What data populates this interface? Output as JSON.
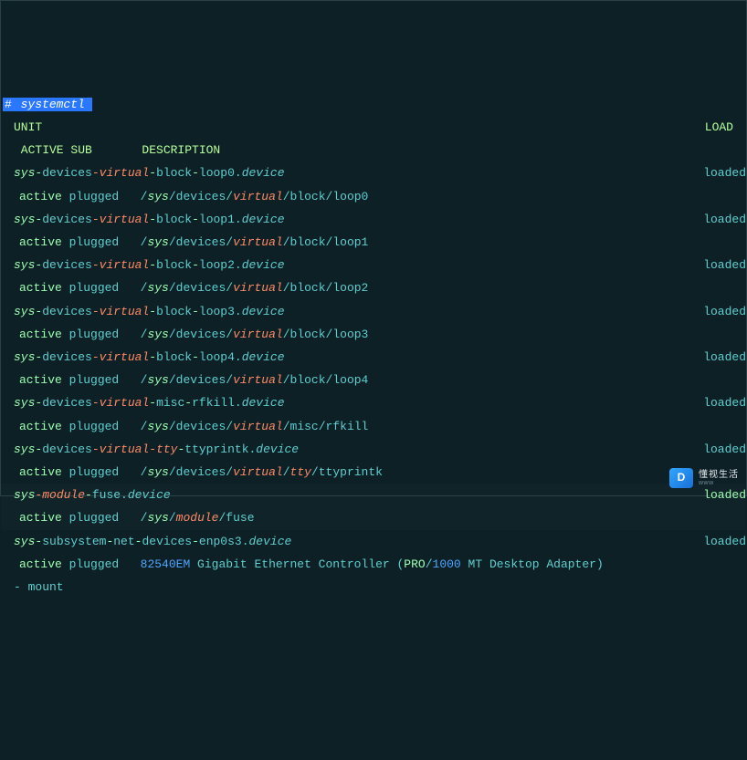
{
  "prompt": {
    "hash": "#",
    "command": " systemctl "
  },
  "header": {
    "unit": "UNIT",
    "load": "LOAD",
    "active": "ACTIVE",
    "sub": "SUB",
    "description": "DESCRIPTION"
  },
  "loaded_label": "loaded",
  "units": [
    {
      "segments": [
        {
          "t": "sys",
          "c": "gi"
        },
        {
          "t": "-",
          "c": "g"
        },
        {
          "t": "devices",
          "c": "t"
        },
        {
          "t": "-",
          "c": "o"
        },
        {
          "t": "virtual",
          "c": "oi"
        },
        {
          "t": "-",
          "c": "g"
        },
        {
          "t": "block",
          "c": "t"
        },
        {
          "t": "-",
          "c": "g"
        },
        {
          "t": "loop0.",
          "c": "t"
        },
        {
          "t": "device",
          "c": "ti"
        }
      ],
      "desc": [
        {
          "t": "active",
          "c": "g"
        },
        {
          "t": " ",
          "c": "t"
        },
        {
          "t": "plugged",
          "c": "t"
        },
        {
          "t": "   /",
          "c": "t"
        },
        {
          "t": "sys",
          "c": "gi"
        },
        {
          "t": "/",
          "c": "t"
        },
        {
          "t": "devices",
          "c": "t"
        },
        {
          "t": "/",
          "c": "t"
        },
        {
          "t": "virtual",
          "c": "oi"
        },
        {
          "t": "/",
          "c": "t"
        },
        {
          "t": "block",
          "c": "t"
        },
        {
          "t": "/",
          "c": "t"
        },
        {
          "t": "loop0",
          "c": "t"
        }
      ],
      "loaded_color": "t"
    },
    {
      "segments": [
        {
          "t": "sys",
          "c": "gi"
        },
        {
          "t": "-",
          "c": "g"
        },
        {
          "t": "devices",
          "c": "t"
        },
        {
          "t": "-",
          "c": "o"
        },
        {
          "t": "virtual",
          "c": "oi"
        },
        {
          "t": "-",
          "c": "g"
        },
        {
          "t": "block",
          "c": "t"
        },
        {
          "t": "-",
          "c": "g"
        },
        {
          "t": "loop1.",
          "c": "t"
        },
        {
          "t": "device",
          "c": "ti"
        }
      ],
      "desc": [
        {
          "t": "active",
          "c": "g"
        },
        {
          "t": " ",
          "c": "t"
        },
        {
          "t": "plugged",
          "c": "t"
        },
        {
          "t": "   /",
          "c": "t"
        },
        {
          "t": "sys",
          "c": "gi"
        },
        {
          "t": "/",
          "c": "t"
        },
        {
          "t": "devices",
          "c": "t"
        },
        {
          "t": "/",
          "c": "t"
        },
        {
          "t": "virtual",
          "c": "oi"
        },
        {
          "t": "/",
          "c": "t"
        },
        {
          "t": "block",
          "c": "t"
        },
        {
          "t": "/",
          "c": "t"
        },
        {
          "t": "loop1",
          "c": "t"
        }
      ],
      "loaded_color": "t"
    },
    {
      "segments": [
        {
          "t": "sys",
          "c": "gi"
        },
        {
          "t": "-",
          "c": "g"
        },
        {
          "t": "devices",
          "c": "t"
        },
        {
          "t": "-",
          "c": "o"
        },
        {
          "t": "virtual",
          "c": "oi"
        },
        {
          "t": "-",
          "c": "g"
        },
        {
          "t": "block",
          "c": "t"
        },
        {
          "t": "-",
          "c": "g"
        },
        {
          "t": "loop2.",
          "c": "t"
        },
        {
          "t": "device",
          "c": "ti"
        }
      ],
      "desc": [
        {
          "t": "active",
          "c": "g"
        },
        {
          "t": " ",
          "c": "t"
        },
        {
          "t": "plugged",
          "c": "t"
        },
        {
          "t": "   /",
          "c": "t"
        },
        {
          "t": "sys",
          "c": "gi"
        },
        {
          "t": "/",
          "c": "t"
        },
        {
          "t": "devices",
          "c": "t"
        },
        {
          "t": "/",
          "c": "t"
        },
        {
          "t": "virtual",
          "c": "oi"
        },
        {
          "t": "/",
          "c": "t"
        },
        {
          "t": "block",
          "c": "t"
        },
        {
          "t": "/",
          "c": "t"
        },
        {
          "t": "loop2",
          "c": "t"
        }
      ],
      "loaded_color": "t"
    },
    {
      "segments": [
        {
          "t": "sys",
          "c": "gi"
        },
        {
          "t": "-",
          "c": "g"
        },
        {
          "t": "devices",
          "c": "t"
        },
        {
          "t": "-",
          "c": "o"
        },
        {
          "t": "virtual",
          "c": "oi"
        },
        {
          "t": "-",
          "c": "g"
        },
        {
          "t": "block",
          "c": "t"
        },
        {
          "t": "-",
          "c": "g"
        },
        {
          "t": "loop3.",
          "c": "t"
        },
        {
          "t": "device",
          "c": "ti"
        }
      ],
      "desc": [
        {
          "t": "active",
          "c": "g"
        },
        {
          "t": " ",
          "c": "t"
        },
        {
          "t": "plugged",
          "c": "t"
        },
        {
          "t": "   /",
          "c": "t"
        },
        {
          "t": "sys",
          "c": "gi"
        },
        {
          "t": "/",
          "c": "t"
        },
        {
          "t": "devices",
          "c": "t"
        },
        {
          "t": "/",
          "c": "t"
        },
        {
          "t": "virtual",
          "c": "oi"
        },
        {
          "t": "/",
          "c": "t"
        },
        {
          "t": "block",
          "c": "t"
        },
        {
          "t": "/",
          "c": "t"
        },
        {
          "t": "loop3",
          "c": "t"
        }
      ],
      "loaded_color": "t"
    },
    {
      "segments": [
        {
          "t": "sys",
          "c": "gi"
        },
        {
          "t": "-",
          "c": "g"
        },
        {
          "t": "devices",
          "c": "t"
        },
        {
          "t": "-",
          "c": "o"
        },
        {
          "t": "virtual",
          "c": "oi"
        },
        {
          "t": "-",
          "c": "g"
        },
        {
          "t": "block",
          "c": "t"
        },
        {
          "t": "-",
          "c": "g"
        },
        {
          "t": "loop4.",
          "c": "t"
        },
        {
          "t": "device",
          "c": "ti"
        }
      ],
      "desc": [
        {
          "t": "active",
          "c": "g"
        },
        {
          "t": " ",
          "c": "t"
        },
        {
          "t": "plugged",
          "c": "t"
        },
        {
          "t": "   /",
          "c": "t"
        },
        {
          "t": "sys",
          "c": "gi"
        },
        {
          "t": "/",
          "c": "t"
        },
        {
          "t": "devices",
          "c": "t"
        },
        {
          "t": "/",
          "c": "t"
        },
        {
          "t": "virtual",
          "c": "oi"
        },
        {
          "t": "/",
          "c": "t"
        },
        {
          "t": "block",
          "c": "t"
        },
        {
          "t": "/",
          "c": "t"
        },
        {
          "t": "loop4",
          "c": "t"
        }
      ],
      "loaded_color": "t"
    },
    {
      "segments": [
        {
          "t": "sys",
          "c": "gi"
        },
        {
          "t": "-",
          "c": "g"
        },
        {
          "t": "devices",
          "c": "t"
        },
        {
          "t": "-",
          "c": "o"
        },
        {
          "t": "virtual",
          "c": "oi"
        },
        {
          "t": "-",
          "c": "g"
        },
        {
          "t": "misc",
          "c": "t"
        },
        {
          "t": "-",
          "c": "g"
        },
        {
          "t": "rfkill.",
          "c": "t"
        },
        {
          "t": "device",
          "c": "ti"
        }
      ],
      "desc": [
        {
          "t": "active",
          "c": "g"
        },
        {
          "t": " ",
          "c": "t"
        },
        {
          "t": "plugged",
          "c": "t"
        },
        {
          "t": "   /",
          "c": "t"
        },
        {
          "t": "sys",
          "c": "gi"
        },
        {
          "t": "/",
          "c": "t"
        },
        {
          "t": "devices",
          "c": "t"
        },
        {
          "t": "/",
          "c": "t"
        },
        {
          "t": "virtual",
          "c": "oi"
        },
        {
          "t": "/",
          "c": "t"
        },
        {
          "t": "misc",
          "c": "t"
        },
        {
          "t": "/",
          "c": "t"
        },
        {
          "t": "rfkill",
          "c": "t"
        }
      ],
      "loaded_color": "t"
    },
    {
      "segments": [
        {
          "t": "sys",
          "c": "gi"
        },
        {
          "t": "-",
          "c": "g"
        },
        {
          "t": "devices",
          "c": "t"
        },
        {
          "t": "-",
          "c": "o"
        },
        {
          "t": "virtual",
          "c": "oi"
        },
        {
          "t": "-",
          "c": "o"
        },
        {
          "t": "tty",
          "c": "oi"
        },
        {
          "t": "-",
          "c": "g"
        },
        {
          "t": "ttyprintk.",
          "c": "t"
        },
        {
          "t": "device",
          "c": "ti"
        }
      ],
      "desc": [
        {
          "t": "active",
          "c": "g"
        },
        {
          "t": " ",
          "c": "t"
        },
        {
          "t": "plugged",
          "c": "t"
        },
        {
          "t": "   /",
          "c": "t"
        },
        {
          "t": "sys",
          "c": "gi"
        },
        {
          "t": "/",
          "c": "t"
        },
        {
          "t": "devices",
          "c": "t"
        },
        {
          "t": "/",
          "c": "t"
        },
        {
          "t": "virtual",
          "c": "oi"
        },
        {
          "t": "/",
          "c": "t"
        },
        {
          "t": "tty",
          "c": "oi"
        },
        {
          "t": "/",
          "c": "t"
        },
        {
          "t": "ttyprintk",
          "c": "t"
        }
      ],
      "loaded_color": "t"
    },
    {
      "hl": true,
      "segments": [
        {
          "t": "sys",
          "c": "gi"
        },
        {
          "t": "-",
          "c": "o"
        },
        {
          "t": "module",
          "c": "oi"
        },
        {
          "t": "-",
          "c": "g"
        },
        {
          "t": "fuse.",
          "c": "t"
        },
        {
          "t": "device",
          "c": "ti"
        }
      ],
      "desc": [
        {
          "t": "active",
          "c": "g"
        },
        {
          "t": " ",
          "c": "t"
        },
        {
          "t": "plugged",
          "c": "t"
        },
        {
          "t": "   /",
          "c": "t"
        },
        {
          "t": "sys",
          "c": "gi"
        },
        {
          "t": "/",
          "c": "t"
        },
        {
          "t": "module",
          "c": "oi"
        },
        {
          "t": "/",
          "c": "t"
        },
        {
          "t": "fuse",
          "c": "t"
        }
      ],
      "loaded_color": "g"
    },
    {
      "segments": [
        {
          "t": "sys",
          "c": "gi"
        },
        {
          "t": "-",
          "c": "g"
        },
        {
          "t": "subsystem",
          "c": "t"
        },
        {
          "t": "-",
          "c": "g"
        },
        {
          "t": "net",
          "c": "t"
        },
        {
          "t": "-",
          "c": "g"
        },
        {
          "t": "devices",
          "c": "t"
        },
        {
          "t": "-",
          "c": "g"
        },
        {
          "t": "enp0s3.",
          "c": "t"
        },
        {
          "t": "device",
          "c": "ti"
        }
      ],
      "desc": [
        {
          "t": "active",
          "c": "g"
        },
        {
          "t": " ",
          "c": "t"
        },
        {
          "t": "plugged",
          "c": "t"
        },
        {
          "t": "   ",
          "c": "t"
        },
        {
          "t": "82540EM",
          "c": "b"
        },
        {
          "t": " Gigabit Ethernet Controller (",
          "c": "t"
        },
        {
          "t": "PRO",
          "c": "g"
        },
        {
          "t": "/",
          "c": "t"
        },
        {
          "t": "1000",
          "c": "b"
        },
        {
          "t": " MT Desktop Adapter)",
          "c": "t"
        }
      ],
      "loaded_color": "t"
    }
  ],
  "last_line": "- mount",
  "watermark": {
    "logo": "D",
    "top": "懂视生活",
    "bottom": "www"
  }
}
